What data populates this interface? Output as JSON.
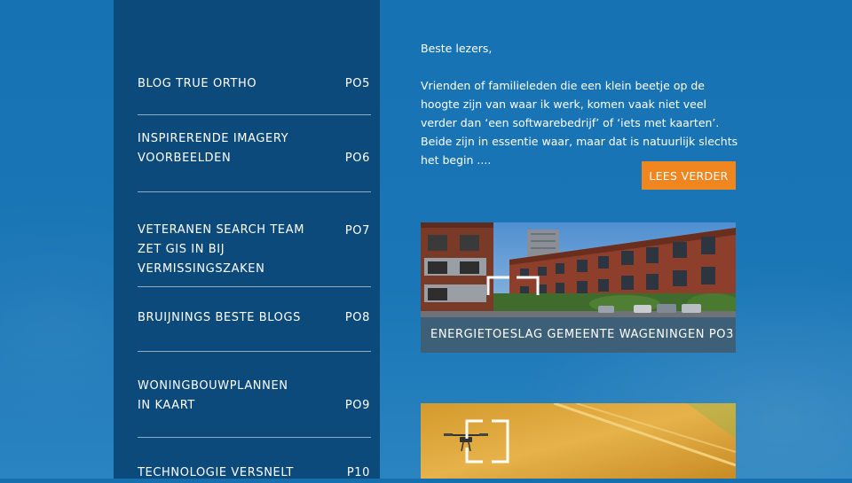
{
  "sidebar": {
    "items": [
      {
        "title": "BLOG TRUE ORTHO",
        "page": "PO5"
      },
      {
        "title": "INSPIRERENDE IMAGERY VOORBEELDEN",
        "page": "PO6"
      },
      {
        "title": "VETERANEN SEARCH TEAM ZET GIS IN BIJ VERMISSINGSZAKEN",
        "page": "PO7"
      },
      {
        "title": "BRUIJNINGS BESTE BLOGS",
        "page": "PO8"
      },
      {
        "title": "WONINGBOUWPLANNEN IN KAART",
        "page": "PO9"
      },
      {
        "title": "TECHNOLOGIE VERSNELT",
        "page": "P10"
      }
    ]
  },
  "intro": {
    "greeting": "Beste lezers,",
    "body": "Vrienden of familieleden die een klein beetje op de hoogte zijn van waar ik werk, komen vaak niet veel verder dan ‘een softwarebedrijf’ of ‘iets met kaarten’. Beide zijn in essentie waar, maar dat is natuurlijk slechts het begin ....",
    "read_more_label": "LEES VERDER"
  },
  "cards": [
    {
      "caption": "ENERGIETOESLAG GEMEENTE WAGENINGEN PO3",
      "image": "houses-street-photo"
    },
    {
      "caption": "",
      "image": "wheat-field-drone-photo"
    }
  ],
  "colors": {
    "background": "#1670b0",
    "sidebar": "#0b4a7a",
    "accent_button": "#f0861f"
  }
}
